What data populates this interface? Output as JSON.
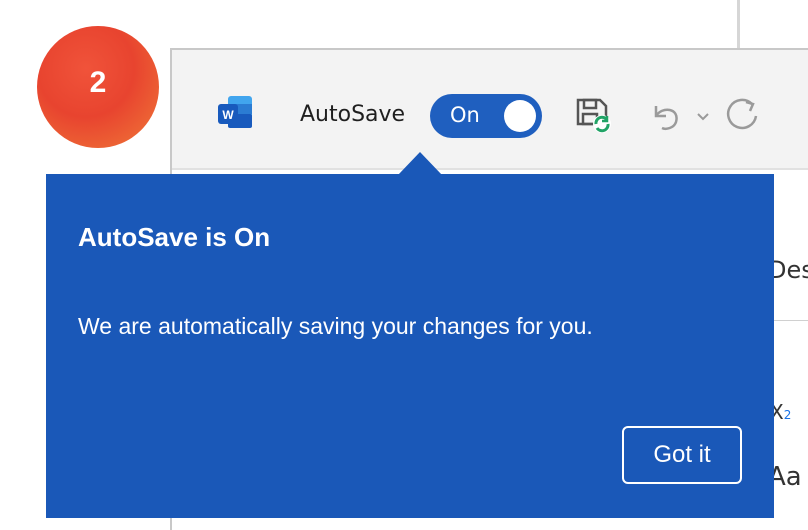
{
  "step": {
    "number": "2"
  },
  "titlebar": {
    "app_icon": "word-icon",
    "autosave_label": "AutoSave",
    "autosave_toggle_state": "On",
    "icons": [
      "save-icon",
      "undo-icon",
      "chevron-down-icon",
      "redo-icon"
    ]
  },
  "ribbon": {
    "partial_tab_label": "Des",
    "style_sample": "Aa",
    "small_sample": "X",
    "small_sample_sub": "2"
  },
  "callout": {
    "title": "AutoSave is On",
    "body": "We are automatically saving your changes for you.",
    "button_label": "Got it"
  },
  "colors": {
    "callout_bg": "#1a58b8",
    "toggle_bg": "#1f5fbf",
    "badge": "#ee4b35",
    "word_blue": "#185abd"
  }
}
